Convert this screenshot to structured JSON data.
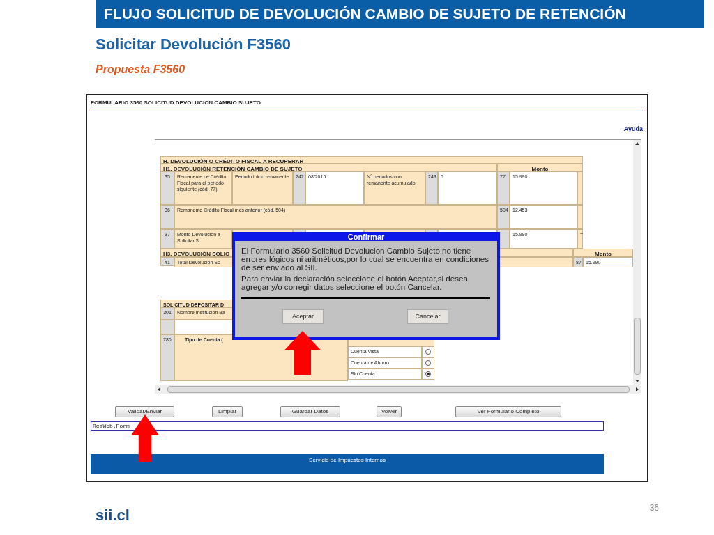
{
  "slide": {
    "header": "FLUJO SOLICITUD DE DEVOLUCIÓN CAMBIO DE SUJETO DE RETENCIÓN",
    "title": "Solicitar Devolución F3560",
    "subtitle": "Propuesta F3560",
    "logo": "sii.cl",
    "page_number": "36"
  },
  "form": {
    "title": "FORMULARIO 3560 SOLICITUD DEVOLUCION CAMBIO SUJETO",
    "help_link": "Ayuda",
    "section_h": {
      "title": "H. DEVOLUCIÓN O CRÉDITO FISCAL A RECUPERAR",
      "subtitle": "H1. DEVOLUCIÓN RETENCIÓN CAMBIO DE SUJETO",
      "amount_header": "Monto",
      "row_35": {
        "number": "35",
        "label": "Remanente de Crédito Fiscal para el periodo siguiente (cód. 77)",
        "label_2": "Periodo inicio remanente",
        "code_2": "242",
        "value_2": "08/2015",
        "label_3": "N° periodos con remanente acumulado",
        "code_3": "243",
        "value_3": "5",
        "code": "77",
        "value": "15.990"
      },
      "row_36": {
        "number": "36",
        "label": "Remanente Crédito Fiscal mes anterior (cód. 504)",
        "code": "504",
        "value": "12.453"
      },
      "row_37": {
        "number": "37",
        "label": "Monto Devolución a Solicitar $",
        "value": "15.990",
        "mark": "="
      }
    },
    "section_h3": {
      "title": "H3. DEVOLUCIÓN SOLIC",
      "amount_header": "Monto",
      "row_41": {
        "number": "41",
        "label": "Total Devolución So",
        "code": "87",
        "value": "15.990"
      }
    },
    "deposit": {
      "title": "SOLICITUD DEPOSITAR D",
      "bank_row": {
        "number": "301",
        "label": "Nombre Institución Ba"
      },
      "account_row": {
        "number": "780",
        "label": "Tipo de Cuenta (",
        "options": [
          {
            "label": "Cuenta Vista",
            "selected": false
          },
          {
            "label": "Cuenta de Ahorro",
            "selected": false
          },
          {
            "label": "Sin Cuenta",
            "selected": true
          }
        ]
      }
    },
    "buttons": [
      "Validar/Enviar",
      "Limpiar",
      "Guardar Datos",
      "Volver",
      "Ver Formulario Completo"
    ],
    "status_field": {
      "value": "RcsWeb.Form"
    },
    "footer": "Servicio de Impuestos Internos"
  },
  "dialog": {
    "title": "Confirmar",
    "paragraphs": [
      "El Formulario 3560 Solicitud Devolucion Cambio Sujeto no tiene errores lógicos ni aritméticos,por lo cual se encuentra en condiciones de ser enviado al SII.",
      "Para enviar la declaración seleccione el botón Aceptar,si desea agregar y/o corregir datos seleccione el botón Cancelar."
    ],
    "buttons": [
      "Aceptar",
      "Cancelar"
    ]
  }
}
